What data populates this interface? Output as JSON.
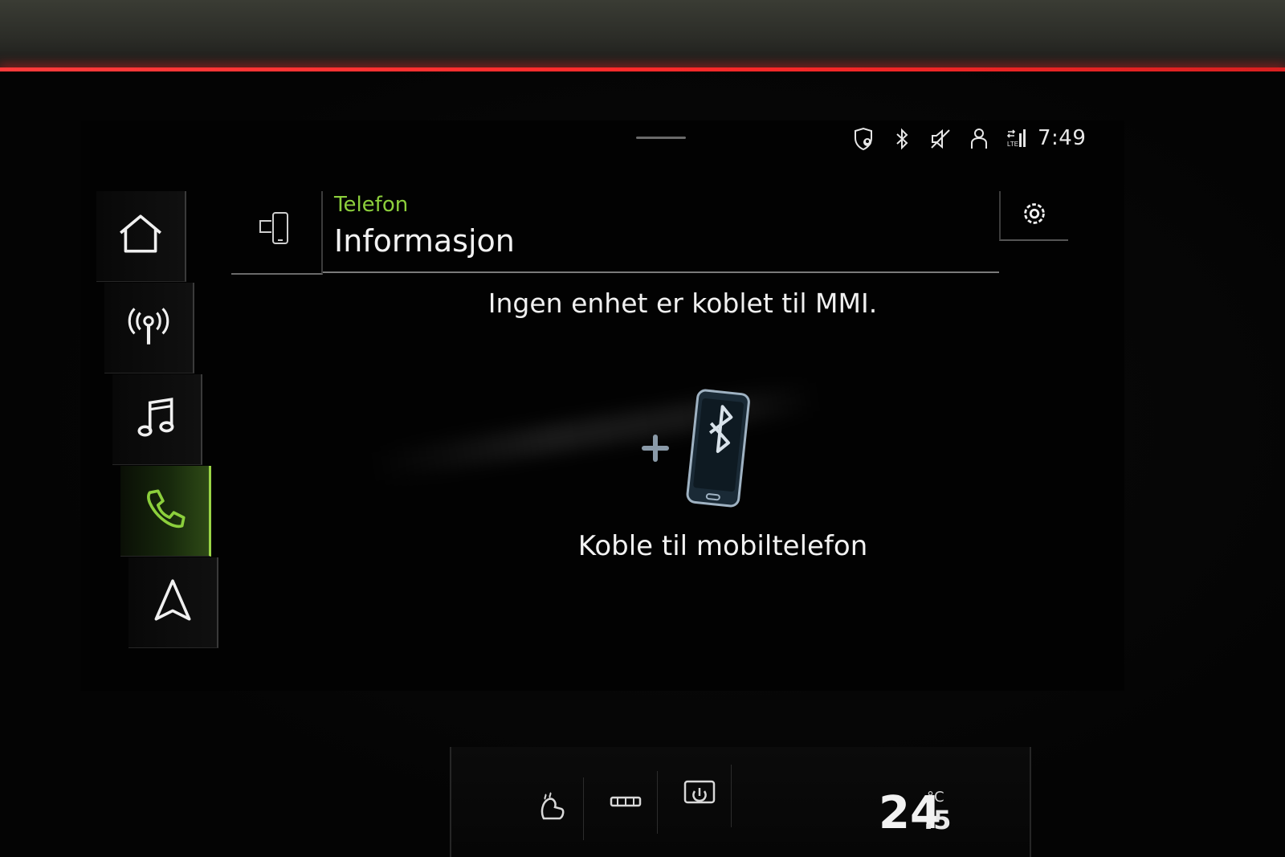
{
  "status_bar": {
    "icons": [
      "location-shield-icon",
      "bluetooth-icon",
      "mute-icon",
      "user-icon",
      "lte-signal-icon"
    ],
    "lte_text": "LTE",
    "time": "7:49"
  },
  "rail": {
    "items": [
      {
        "name": "home",
        "icon": "home-icon"
      },
      {
        "name": "radio",
        "icon": "radio-antenna-icon"
      },
      {
        "name": "media",
        "icon": "music-note-icon"
      },
      {
        "name": "phone",
        "icon": "phone-icon",
        "active": true
      },
      {
        "name": "navigation",
        "icon": "navigation-arrow-icon"
      }
    ]
  },
  "header": {
    "kicker": "Telefon",
    "title": "Informasjon"
  },
  "main": {
    "message": "Ingen enhet er koblet til MMI.",
    "connect_label": "Koble til mobiltelefon"
  },
  "climate": {
    "buttons": [
      "seat-heating-icon",
      "defrost-icon",
      "power-screen-icon"
    ],
    "temperature_int": "24",
    "temperature_dec": ".5",
    "temperature_unit": "°C"
  },
  "colors": {
    "accent": "#8ccf3c",
    "ambient": "#ff2a2a",
    "text": "#f2f2f2"
  }
}
